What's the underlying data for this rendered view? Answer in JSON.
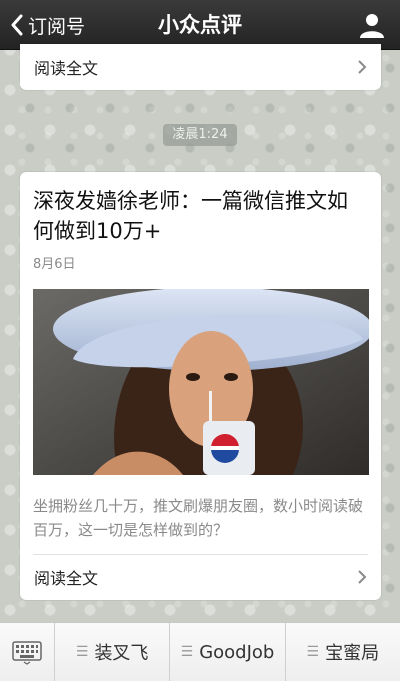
{
  "header": {
    "back_label": "订阅号",
    "title": "小众点评"
  },
  "top_card": {
    "read_more": "阅读全文"
  },
  "time_label": "凌晨1:24",
  "article": {
    "title": "深夜发嫱徐老师：一篇微信推文如何做到10万+",
    "date": "8月6日",
    "summary": "坐拥粉丝几十万，推文刷爆朋友圈，数小时阅读破百万，这一切是怎样做到的？",
    "read_more": "阅读全文"
  },
  "menu": {
    "items": [
      {
        "label": "装叉飞"
      },
      {
        "label": "GoodJob"
      },
      {
        "label": "宝蜜局"
      }
    ]
  },
  "icons": {
    "back": "chevron-left-icon",
    "profile": "person-icon",
    "keyboard": "keyboard-icon",
    "menu": "menu-lines-icon",
    "arrow": "chevron-right-icon"
  }
}
